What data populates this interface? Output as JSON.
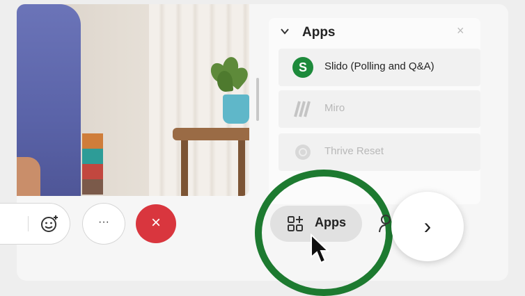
{
  "apps_panel": {
    "title": "Apps",
    "close_icon": "close-icon",
    "items": [
      {
        "name": "Slido (Polling and Q&A)",
        "badge_letter": "S",
        "enabled": true
      },
      {
        "name": "Miro",
        "enabled": false
      },
      {
        "name": "Thrive Reset",
        "enabled": false
      }
    ]
  },
  "toolbar": {
    "apps_label": "Apps",
    "more_label": "···",
    "leave_label": "×",
    "next_label": "›"
  },
  "colors": {
    "highlight_ring": "#1d7a30",
    "slido_green": "#1d8a3b",
    "leave_red": "#d9363e"
  }
}
